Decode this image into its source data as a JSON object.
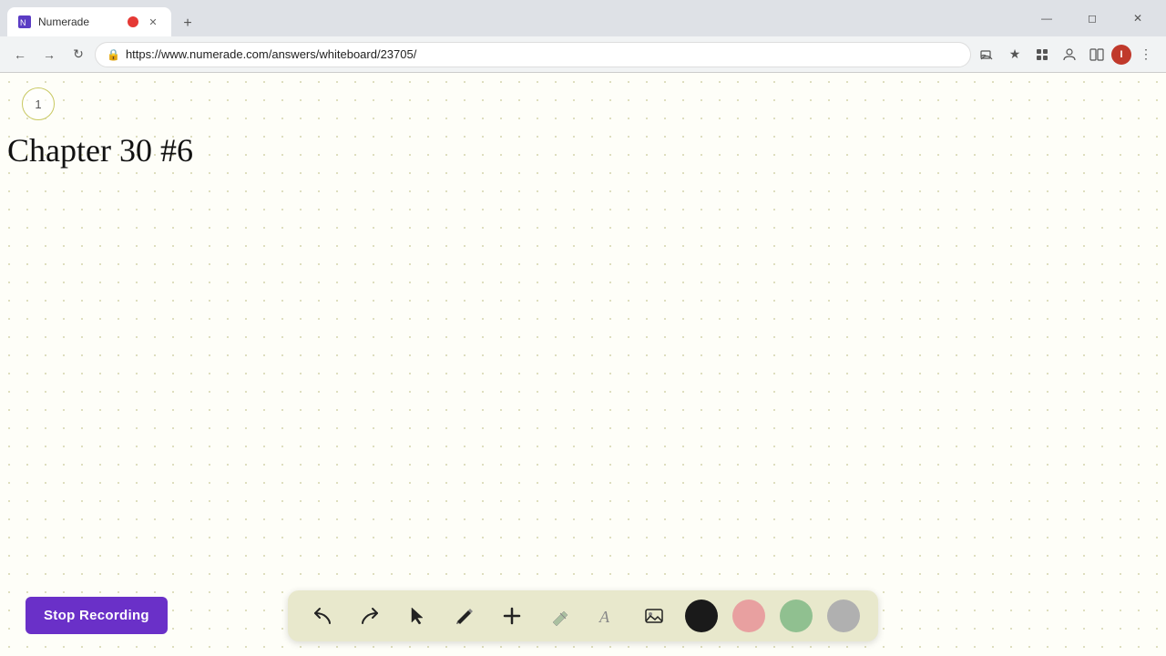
{
  "browser": {
    "tab": {
      "title": "Numerade",
      "record_dot": true,
      "url": "https://www.numerade.com/answers/whiteboard/23705/"
    },
    "window_controls": {
      "minimize": "—",
      "maximize": "❐",
      "close": "✕"
    },
    "nav": {
      "back_disabled": false,
      "forward_disabled": false
    }
  },
  "whiteboard": {
    "page_number": "1",
    "title": "Chapter 30 #6"
  },
  "toolbar": {
    "tools": [
      {
        "name": "undo",
        "icon": "↩",
        "label": "Undo"
      },
      {
        "name": "redo",
        "icon": "↪",
        "label": "Redo"
      },
      {
        "name": "select",
        "icon": "▲",
        "label": "Select"
      },
      {
        "name": "pencil",
        "icon": "✏",
        "label": "Pencil"
      },
      {
        "name": "add",
        "icon": "+",
        "label": "Add"
      },
      {
        "name": "eraser",
        "icon": "⌫",
        "label": "Eraser"
      },
      {
        "name": "text",
        "icon": "A",
        "label": "Text"
      },
      {
        "name": "image",
        "icon": "🖼",
        "label": "Image"
      }
    ],
    "colors": [
      {
        "name": "black",
        "value": "#1a1a1a"
      },
      {
        "name": "pink",
        "value": "#e8a0a0"
      },
      {
        "name": "green",
        "value": "#90c090"
      },
      {
        "name": "gray",
        "value": "#b0b0b0"
      }
    ]
  },
  "stop_recording": {
    "label": "Stop Recording"
  }
}
